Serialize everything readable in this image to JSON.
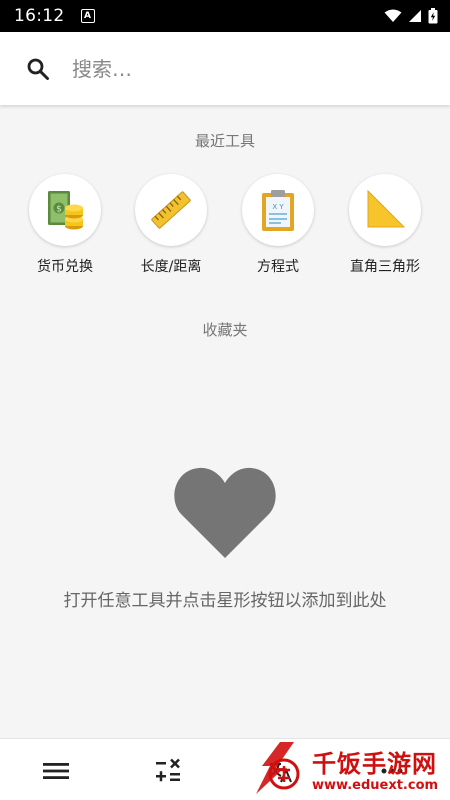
{
  "status_bar": {
    "time": "16:12",
    "notification_badge": "A",
    "icons": [
      "wifi-icon",
      "signal-icon",
      "battery-charging-icon"
    ]
  },
  "search": {
    "placeholder": "搜索…",
    "icon": "search-icon"
  },
  "recent_tools": {
    "title": "最近工具",
    "items": [
      {
        "label": "货币兑换",
        "icon": "currency-exchange-icon"
      },
      {
        "label": "长度/距离",
        "icon": "ruler-icon"
      },
      {
        "label": "方程式",
        "icon": "equation-clipboard-icon"
      },
      {
        "label": "直角三角形",
        "icon": "right-triangle-icon"
      }
    ]
  },
  "favorites": {
    "title": "收藏夹",
    "icon": "heart-icon",
    "empty_message": "打开任意工具并点击星形按钮以添加到此处"
  },
  "bottom_nav": {
    "items": [
      {
        "icon": "menu-icon"
      },
      {
        "icon": "calculator-icon"
      },
      {
        "icon": "translate-icon"
      },
      {
        "icon": "more-icon"
      }
    ]
  },
  "watermark": {
    "title": "千饭手游网",
    "url": "www.eduext.com"
  },
  "colors": {
    "background": "#f5f5f5",
    "heart": "#757575",
    "watermark": "#d01010",
    "currency_green": "#5a8a3c",
    "coin_gold": "#f5c518",
    "ruler_yellow": "#f2c12e",
    "triangle_yellow": "#f7c52b"
  }
}
